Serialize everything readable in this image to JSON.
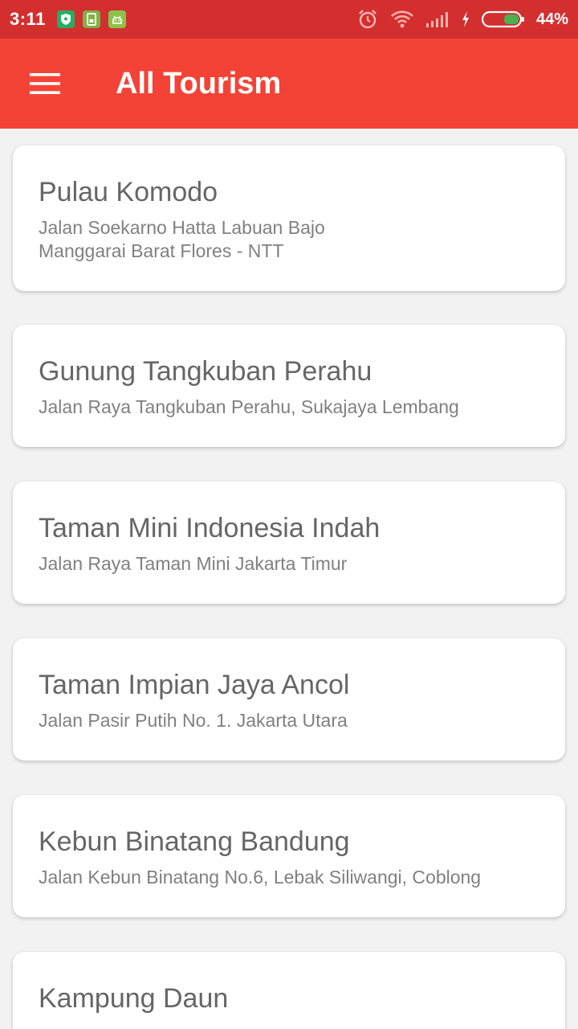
{
  "status_bar": {
    "time": "3:11",
    "battery": "44%",
    "notification_icons": [
      "shield-icon",
      "sim-card-icon",
      "android-icon"
    ],
    "system_icons": [
      "alarm-icon",
      "wifi-icon",
      "signal-icon",
      "charging-icon",
      "battery-icon"
    ]
  },
  "app_bar": {
    "title": "All Tourism",
    "color": "#f44336",
    "status_color": "#d32f2f"
  },
  "places": [
    {
      "name": "Pulau Komodo",
      "address": "Jalan Soekarno Hatta Labuan Bajo\nManggarai Barat Flores - NTT"
    },
    {
      "name": "Gunung Tangkuban Perahu",
      "address": "Jalan Raya Tangkuban Perahu, Sukajaya Lembang"
    },
    {
      "name": "Taman Mini Indonesia Indah",
      "address": "Jalan Raya Taman Mini Jakarta Timur"
    },
    {
      "name": "Taman Impian Jaya Ancol",
      "address": "Jalan Pasir Putih No. 1. Jakarta Utara"
    },
    {
      "name": "Kebun Binatang Bandung",
      "address": "Jalan Kebun Binatang No.6, Lebak Siliwangi, Coblong"
    },
    {
      "name": "Kampung Daun",
      "address": ""
    }
  ]
}
